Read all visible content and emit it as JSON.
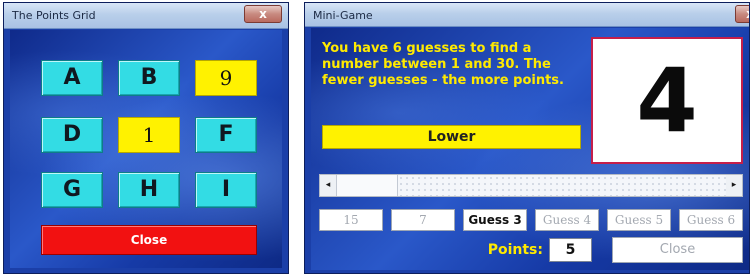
{
  "points_grid": {
    "title": "The Points Grid",
    "close_x": "x",
    "cells": [
      {
        "label": "A",
        "kind": "button"
      },
      {
        "label": "B",
        "kind": "button"
      },
      {
        "label": "9",
        "kind": "value"
      },
      {
        "label": "D",
        "kind": "button"
      },
      {
        "label": "1",
        "kind": "value"
      },
      {
        "label": "F",
        "kind": "button"
      },
      {
        "label": "G",
        "kind": "button"
      },
      {
        "label": "H",
        "kind": "button"
      },
      {
        "label": "I",
        "kind": "button"
      }
    ],
    "close_label": "Close",
    "colors": {
      "cell": "#33dce4",
      "value": "#fff200",
      "close": "#f21111",
      "background": "#1b3fa8"
    }
  },
  "mini_game": {
    "title": "Mini-Game",
    "close_x": "x",
    "instructions": "You have 6 guesses to find a number between 1 and 30.  The fewer guesses - the more points.",
    "current_number": "4",
    "hint": "Lower",
    "scrollbar": {
      "left_arrow": "◂",
      "right_arrow": "▸",
      "position_fraction": 0.05
    },
    "guesses": [
      {
        "label": "15",
        "state": "used"
      },
      {
        "label": "7",
        "state": "used"
      },
      {
        "label": "Guess 3",
        "state": "active"
      },
      {
        "label": "Guess 4",
        "state": "disabled"
      },
      {
        "label": "Guess 5",
        "state": "disabled"
      },
      {
        "label": "Guess 6",
        "state": "disabled"
      }
    ],
    "points_label": "Points:",
    "points_value": "5",
    "close_label": "Close",
    "colors": {
      "text": "#ffea00",
      "display_border": "#c51f4a",
      "hint": "#fff200"
    }
  }
}
